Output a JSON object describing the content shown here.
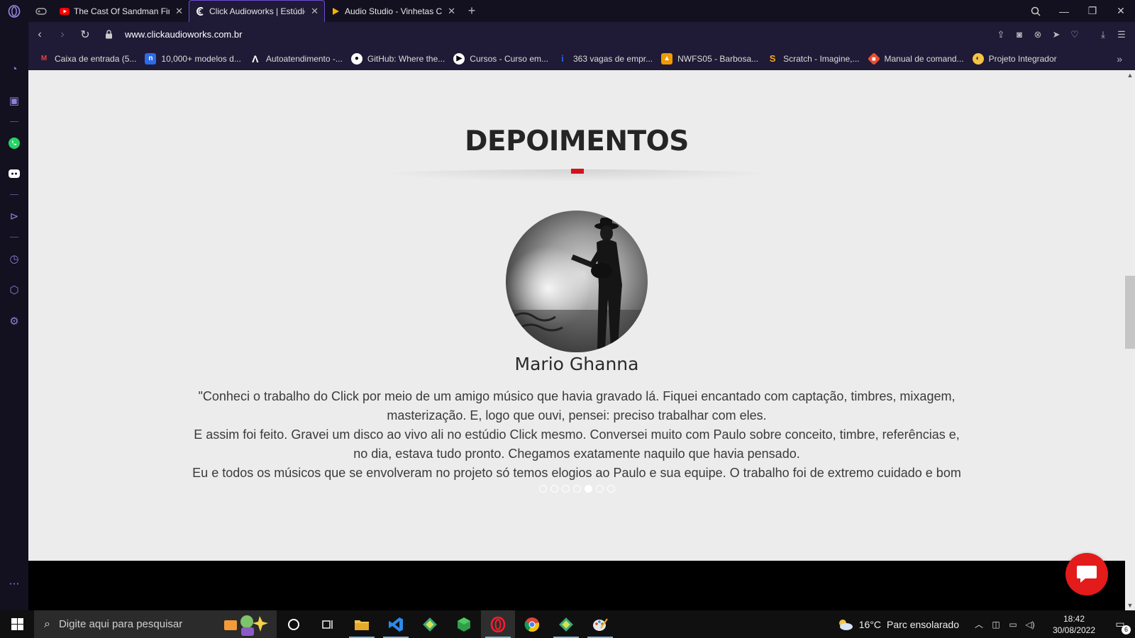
{
  "browser": {
    "tabs": [
      {
        "title": "The Cast Of Sandman Finds",
        "favicon": "youtube-icon",
        "active": false
      },
      {
        "title": "Click Audioworks | Estúdio",
        "favicon": "click-audioworks-icon",
        "active": true
      },
      {
        "title": "Audio Studio - Vinhetas Ca",
        "favicon": "play-triangle-icon",
        "active": false
      }
    ],
    "new_tab_label": "+",
    "url": "www.clickaudioworks.com.br",
    "bookmarks": [
      {
        "label": "Caixa de entrada (5...",
        "icon": "gmail-icon"
      },
      {
        "label": "10,000+ modelos d...",
        "icon": "notion-icon"
      },
      {
        "label": "Autoatendimento -...",
        "icon": "lambda-icon"
      },
      {
        "label": "GitHub: Where the...",
        "icon": "github-icon"
      },
      {
        "label": "Cursos - Curso em...",
        "icon": "youtube-icon"
      },
      {
        "label": "363 vagas de empr...",
        "icon": "indeed-icon"
      },
      {
        "label": "NWFS05 - Barbosa...",
        "icon": "classroom-icon"
      },
      {
        "label": "Scratch - Imagine,...",
        "icon": "scratch-icon"
      },
      {
        "label": "Manual de comand...",
        "icon": "git-icon"
      },
      {
        "label": "Projeto Integrador",
        "icon": "projeto-icon"
      }
    ]
  },
  "page": {
    "section_title": "DEPOIMENTOS",
    "testimonial": {
      "name": "Mario Ghanna",
      "lines": [
        "\"Conheci o trabalho do Click por meio de um amigo músico que havia gravado lá. Fiquei encantado com captação, timbres, mixagem,",
        "masterização. E, logo que ouvi, pensei: preciso trabalhar com eles.",
        "E assim foi feito. Gravei um disco ao vivo ali no estúdio Click mesmo. Conversei muito com Paulo sobre conceito, timbre, referências e,",
        "no dia, estava tudo pronto. Chegamos exatamente naquilo que havia pensado.",
        "Eu e todos os músicos que se envolveram no projeto só temos elogios ao Paulo e sua equipe. O trabalho foi de extremo cuidado e bom"
      ]
    },
    "carousel": {
      "total": 7,
      "active_index": 4
    },
    "accent_color": "#d2121d"
  },
  "taskbar": {
    "search_placeholder": "Digite aqui para pesquisar",
    "weather_temp": "16°C",
    "weather_text": "Parc ensolarado",
    "time": "18:42",
    "date": "30/08/2022",
    "notification_count": "6"
  }
}
